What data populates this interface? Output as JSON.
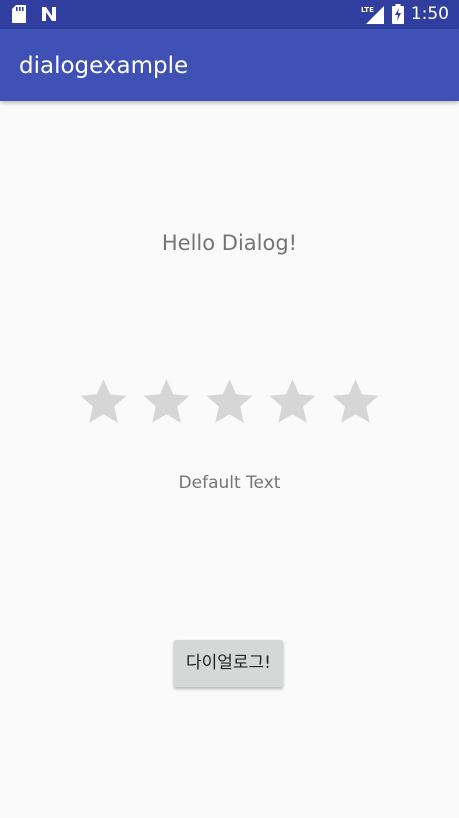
{
  "status_bar": {
    "time": "1:50",
    "network": "LTE",
    "left_icons": [
      "sd-card-icon",
      "n-notification-icon"
    ],
    "right_icons": [
      "lte-signal-icon",
      "battery-charging-icon"
    ]
  },
  "app_bar": {
    "title": "dialogexample"
  },
  "main": {
    "hello_text": "Hello Dialog!",
    "rating": {
      "max_stars": 5,
      "value": 0
    },
    "default_text": "Default Text",
    "dialog_button_label": "다이얼로그!"
  },
  "colors": {
    "status_bar": "#303f9f",
    "app_bar": "#3f51b5",
    "star_empty": "#d6d6d6",
    "background": "#fafafa"
  }
}
